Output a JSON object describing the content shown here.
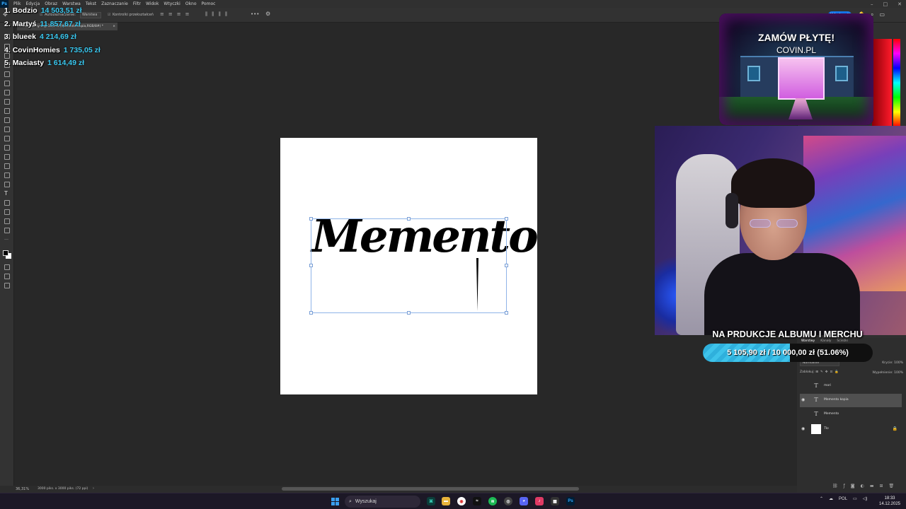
{
  "menu": {
    "app_icon": "Ps",
    "items": [
      "Plik",
      "Edycja",
      "Obraz",
      "Warstwa",
      "Tekst",
      "Zaznaczanie",
      "Filtr",
      "Widok",
      "Wtyczki",
      "Okno",
      "Pomoc"
    ]
  },
  "options": {
    "auto_select": "Autozaznaczanie:",
    "layer_select": "Warstwa",
    "transform_controls": "Kontrolki przekształceń",
    "more": "•••",
    "share": "Udostępnij"
  },
  "document": {
    "tab_title": "Bez nazwy-1 @ 36,3 % (Memento kopia,RGB/8#) *",
    "canvas_text": "Memento"
  },
  "status": {
    "zoom": "36,31%",
    "doc_info": "3000 piks. x 3000 piks. (72 ppi)"
  },
  "leaderboard": [
    {
      "rank": "1.",
      "name": "Bodzio",
      "amount": "14 503,51 zł"
    },
    {
      "rank": "2.",
      "name": "Martyś",
      "amount": "11 857,67 zł"
    },
    {
      "rank": "3.",
      "name": "blueek",
      "amount": "4 214,69 zł"
    },
    {
      "rank": "4.",
      "name": "CovinHomies",
      "amount": "1 735,05 zł"
    },
    {
      "rank": "5.",
      "name": "Maciasty",
      "amount": "1 614,49 zł"
    }
  ],
  "promo": {
    "title": "ZAMÓW PŁYTĘ!",
    "subtitle": "COVIN.PL"
  },
  "goal": {
    "title": "NA PRDUKCJE ALBUMU I MERCHU",
    "text": "5 105,90 zł / 10 000,00 zł (51.06%)",
    "progress": 0.5106
  },
  "layers_panel": {
    "tabs": [
      "Warstwy",
      "Kanały",
      "Ścieżki"
    ],
    "blend_mode": "Normalnie",
    "opacity_label": "Krycie:",
    "opacity_value": "100%",
    "fill_label": "Wypełnienie:",
    "fill_value": "100%",
    "lock_label": "Zablokuj:",
    "layers": [
      {
        "name": "mori",
        "type": "T",
        "visible": false,
        "selected": false
      },
      {
        "name": "Memento kopia",
        "type": "T",
        "visible": true,
        "selected": true
      },
      {
        "name": "Memento",
        "type": "T",
        "visible": false,
        "selected": false
      },
      {
        "name": "Tło",
        "type": "bg",
        "visible": true,
        "selected": false,
        "locked": true
      }
    ]
  },
  "taskbar": {
    "search_placeholder": "Wyszukaj",
    "language": "POL",
    "time": "18:33",
    "date": "14.12.2025"
  },
  "colors": {
    "accent": "#1473e6",
    "leaderboard_amount": "#3ac8f0",
    "goal_fill": "#3ec3ea"
  }
}
